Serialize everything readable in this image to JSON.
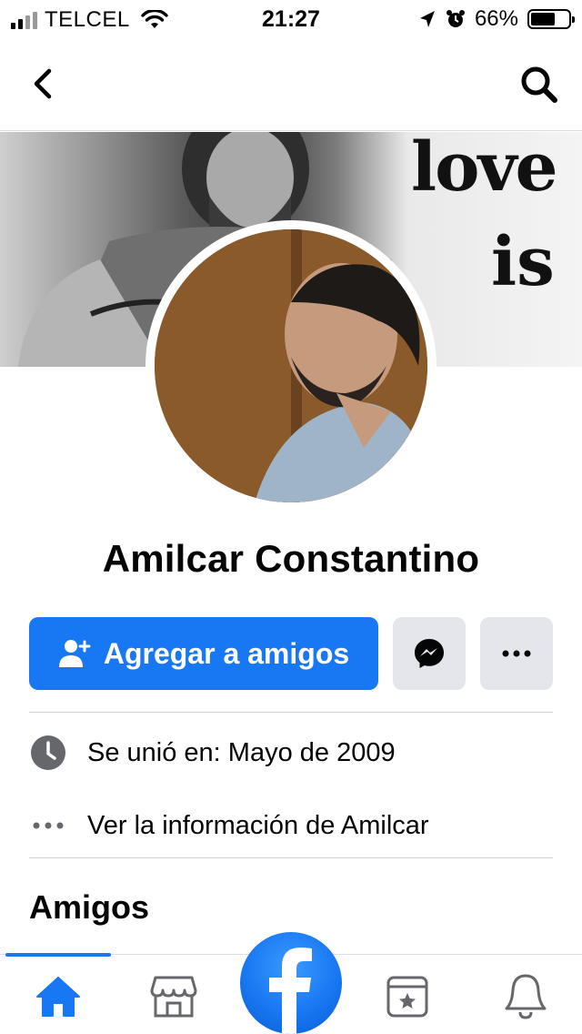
{
  "status_bar": {
    "carrier": "TELCEL",
    "time": "21:27",
    "battery_percent": "66%",
    "battery_level": 0.66,
    "icons": [
      "signal-icon",
      "wifi-icon",
      "location-icon",
      "alarm-icon",
      "battery-icon"
    ]
  },
  "nav": {
    "back_icon": "chevron-left-icon",
    "search_icon": "search-icon"
  },
  "cover": {
    "text_line1": "love",
    "text_line2": "is"
  },
  "profile": {
    "name": "Amilcar Constantino"
  },
  "actions": {
    "add_friend_label": "Agregar a amigos",
    "add_friend_icon": "add-user-icon",
    "messenger_icon": "messenger-icon",
    "more_icon": "more-icon",
    "accent_color": "#1877f2"
  },
  "info": {
    "joined": "Se unió en: Mayo de 2009",
    "see_info": "Ver la información de Amilcar"
  },
  "friends": {
    "title": "Amigos"
  },
  "tab_bar": {
    "tabs": [
      "home-icon",
      "marketplace-icon",
      "facebook-logo-icon",
      "pages-icon",
      "notifications-icon"
    ],
    "active": "home-icon"
  }
}
